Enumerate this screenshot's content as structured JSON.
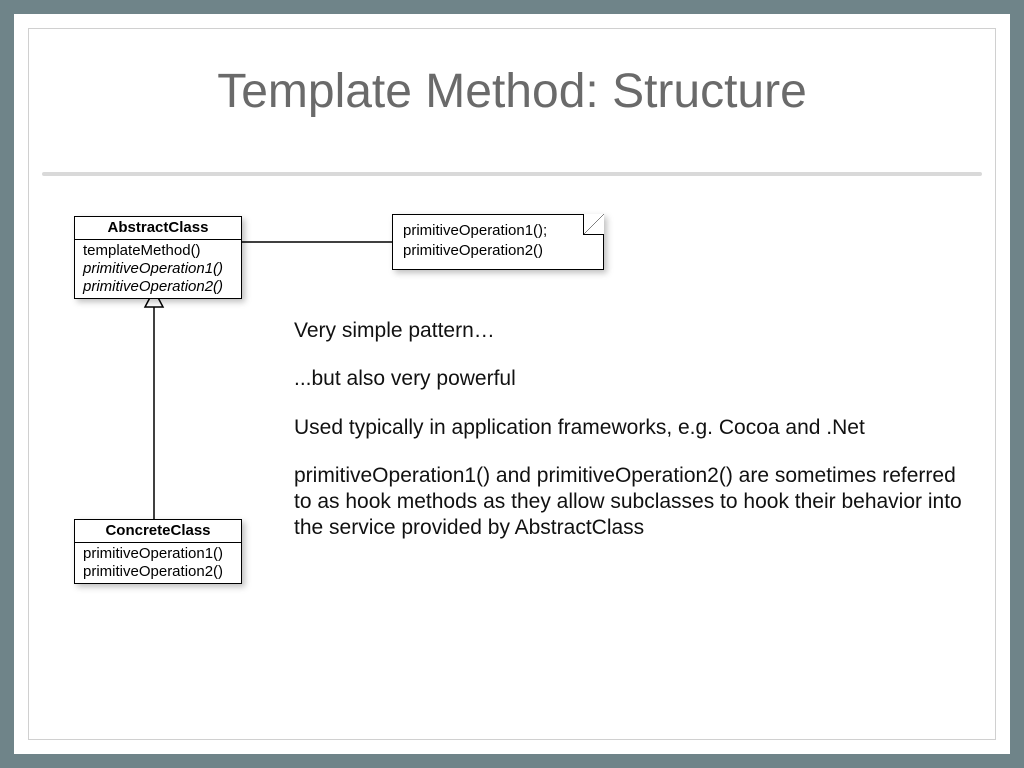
{
  "title": "Template Method: Structure",
  "abstract": {
    "name": "AbstractClass",
    "m1": "templateMethod()",
    "m2": "primitiveOperation1()",
    "m3": "primitiveOperation2()"
  },
  "concrete": {
    "name": "ConcreteClass",
    "m1": "primitiveOperation1()",
    "m2": "primitiveOperation2()"
  },
  "note": {
    "line1": "primitiveOperation1();",
    "line2": "primitiveOperation2()"
  },
  "para1": "Very simple pattern…",
  "para2": "...but also very powerful",
  "para3": "Used typically in application frameworks, e.g. Cocoa and .Net",
  "para4": "primitiveOperation1() and primitiveOperation2() are sometimes referred to as hook methods as they allow subclasses to hook their behavior into the service provided by AbstractClass"
}
